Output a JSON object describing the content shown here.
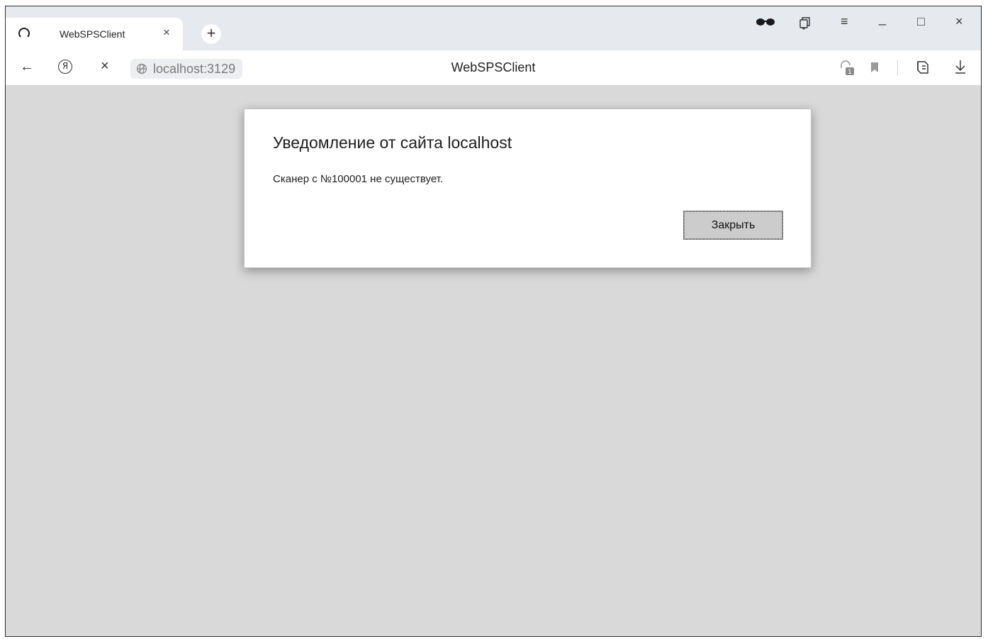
{
  "tab": {
    "title": "WebSPSClient",
    "close_glyph": "×",
    "new_tab_glyph": "+"
  },
  "window_controls": {
    "incognito_icon": "glasses-icon",
    "collections_icon": "collections-icon",
    "menu_glyph": "≡",
    "minimize_glyph": "_",
    "maximize_glyph": "□",
    "close_glyph": "×"
  },
  "navbar": {
    "back_glyph": "←",
    "yandex_glyph": "Я",
    "stop_glyph": "×",
    "url": "localhost:3129",
    "page_title": "WebSPSClient",
    "download_glyph": "↓"
  },
  "dialog": {
    "title": "Уведомление от сайта localhost",
    "message": "Сканер с №100001 не существует.",
    "close_button": "Закрыть"
  },
  "colors": {
    "content_bg": "#d9d9d9",
    "tabstrip_bg": "#e6e9ee",
    "dialog_button_bg": "#cccccc"
  }
}
